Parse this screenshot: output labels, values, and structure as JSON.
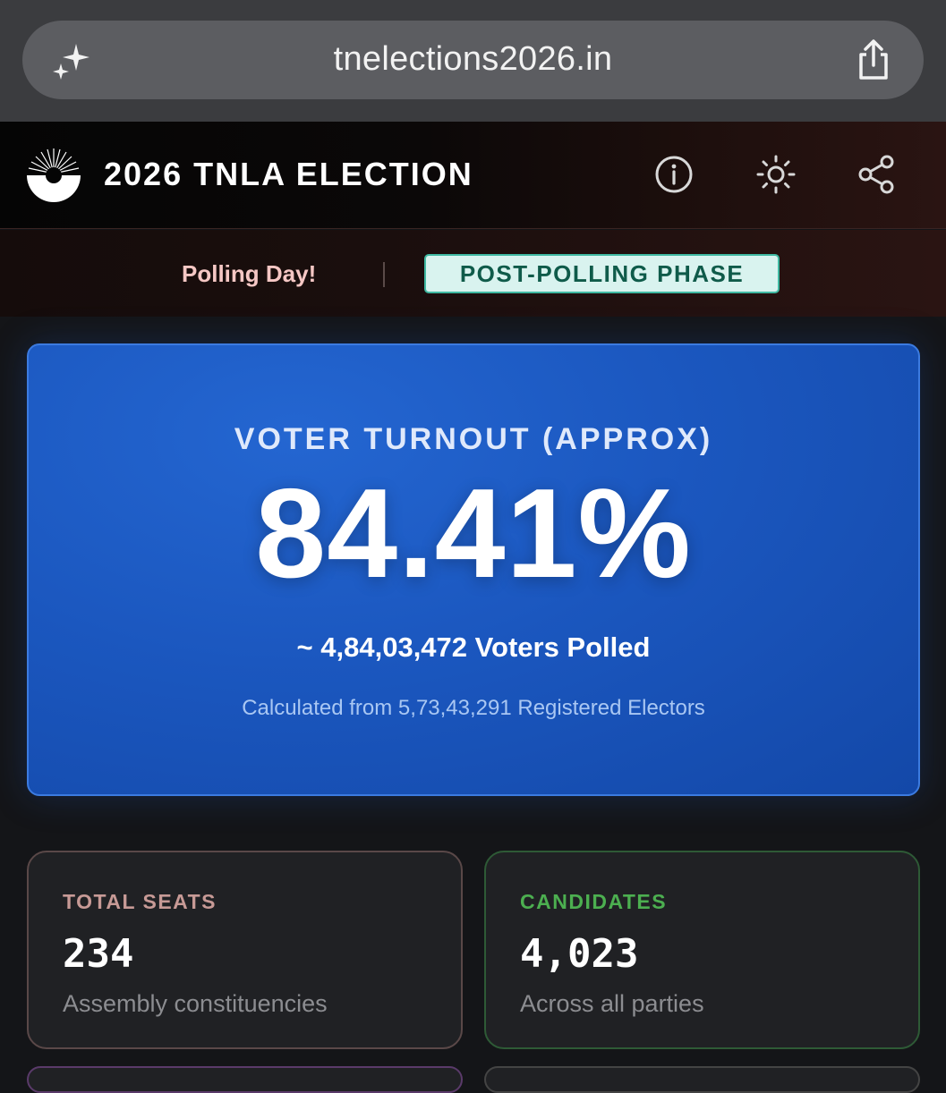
{
  "browser": {
    "url": "tnelections2026.in",
    "sparkle_icon": "sparkle-icon",
    "share_icon": "share-upload-icon"
  },
  "header": {
    "title": "2026 TNLA ELECTION",
    "icons": [
      "info-icon",
      "brightness-icon",
      "share-icon"
    ]
  },
  "phase": {
    "polling_day": "Polling Day!",
    "current_phase": "POST-POLLING PHASE"
  },
  "turnout": {
    "label": "VOTER TURNOUT (APPROX)",
    "value": "84.41%",
    "voters_polled": "~ 4,84,03,472 Voters Polled",
    "electors_note": "Calculated from 5,73,43,291 Registered Electors"
  },
  "stats": {
    "seats": {
      "label": "TOTAL SEATS",
      "value": "234",
      "sub": "Assembly constituencies"
    },
    "candidates": {
      "label": "CANDIDATES",
      "value": "4,023",
      "sub": "Across all parties"
    }
  },
  "colors": {
    "turnout_card": "#1b57bf",
    "phase_badge_bg": "#d9f3ef",
    "phase_badge_text": "#0f5b4a",
    "seats_label": "#c79a96",
    "candidates_label": "#4caf50"
  }
}
